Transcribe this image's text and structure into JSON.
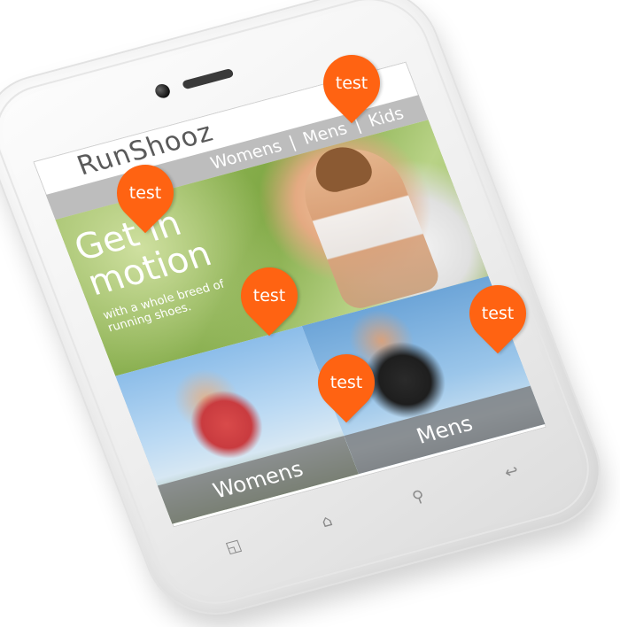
{
  "app": {
    "brand": "RunShooz",
    "nav": [
      "Womens",
      "Mens",
      "Kids"
    ],
    "nav_separator": "|"
  },
  "hero": {
    "title": "Get in motion",
    "subtitle": "with a whole breed of running shoes."
  },
  "tiles": {
    "womens": "Womens",
    "mens": "Mens"
  },
  "markers": [
    "test",
    "test",
    "test",
    "test",
    "test"
  ],
  "device_buttons": [
    "recent-apps-icon",
    "home-icon",
    "search-icon",
    "back-icon"
  ],
  "colors": {
    "marker": "#ff6312",
    "nav_bar": "#bdbdbd",
    "brand_text": "#5a5a5a"
  }
}
